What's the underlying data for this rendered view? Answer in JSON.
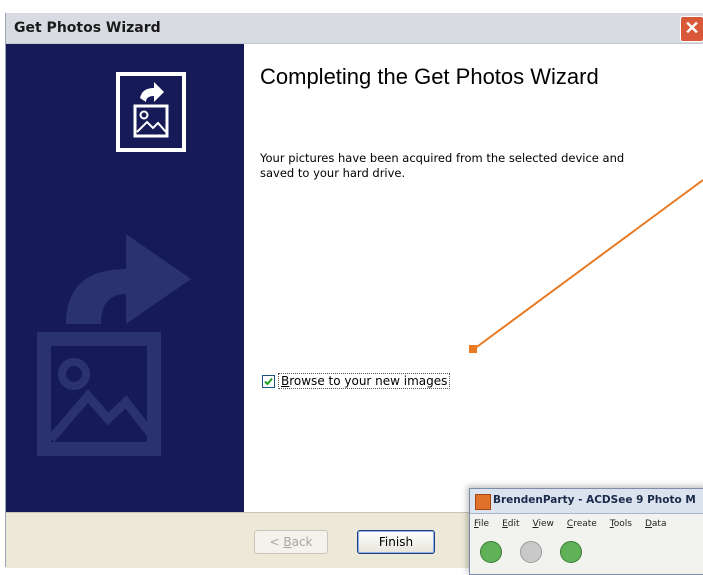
{
  "window": {
    "title": "Get Photos Wizard",
    "close_label": "✕"
  },
  "content": {
    "heading": "Completing the Get Photos Wizard",
    "description": "Your pictures have been acquired from the selected device and saved to your hard drive."
  },
  "checkbox": {
    "label_prefix": "",
    "label_mnemonic": "B",
    "label_rest": "rowse to your new images",
    "checked": true
  },
  "buttons": {
    "back_prefix": "< ",
    "back_mnemonic": "B",
    "back_rest": "ack",
    "finish": "Finish"
  },
  "acdsee": {
    "title": "BrendenParty - ACDSee 9 Photo M",
    "menu": [
      {
        "mnemonic": "F",
        "rest": "ile"
      },
      {
        "mnemonic": "E",
        "rest": "dit"
      },
      {
        "mnemonic": "V",
        "rest": "iew"
      },
      {
        "mnemonic": "C",
        "rest": "reate"
      },
      {
        "mnemonic": "T",
        "rest": "ools"
      },
      {
        "mnemonic": "D",
        "rest": "ata"
      }
    ]
  },
  "colors": {
    "left_panel": "#161a57",
    "arrow": "#e87a23",
    "close_button": "#d9583a"
  },
  "icons": [
    "close-icon",
    "photo-import-icon",
    "photo-import-art",
    "checkmark-icon",
    "app-icon"
  ]
}
